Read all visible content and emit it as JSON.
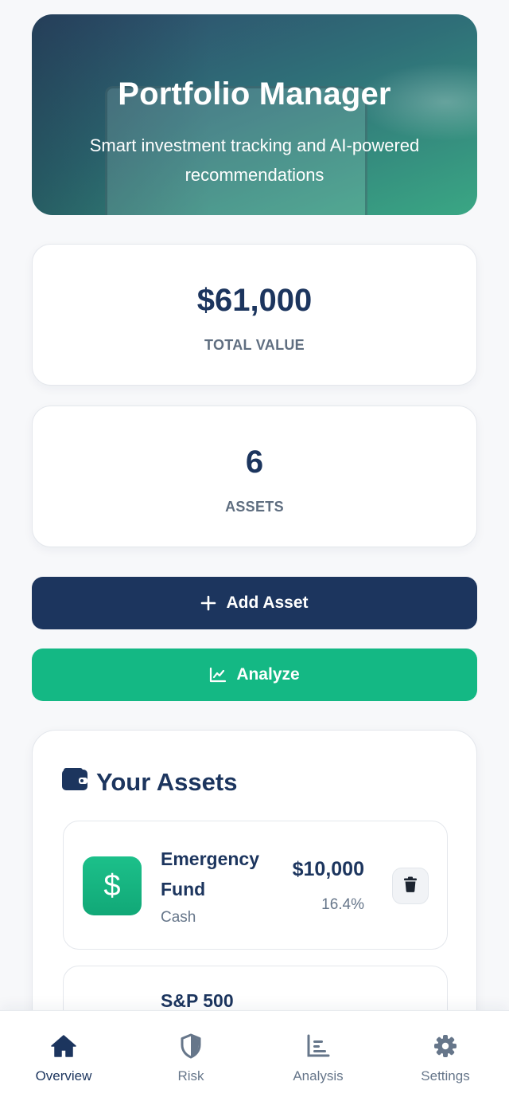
{
  "hero": {
    "title": "Portfolio Manager",
    "subtitle": "Smart investment tracking and AI-powered recommendations"
  },
  "stats": {
    "total_value": "$61,000",
    "total_value_label": "TOTAL VALUE",
    "asset_count": "6",
    "asset_count_label": "ASSETS"
  },
  "actions": {
    "add_label": "Add Asset",
    "add_icon": "plus-icon",
    "analyze_label": "Analyze",
    "analyze_icon": "line-chart-icon"
  },
  "assets": {
    "title": "Your Assets",
    "title_icon": "wallet-icon",
    "items": [
      {
        "name": "Emergency Fund",
        "type": "Cash",
        "value": "$10,000",
        "percent": "16.4%",
        "icon": "dollar-icon",
        "icon_symbol": "$"
      },
      {
        "name": "S&P 500"
      }
    ]
  },
  "nav": {
    "active": "Overview",
    "items": [
      {
        "label": "Overview",
        "icon": "home-icon"
      },
      {
        "label": "Risk",
        "icon": "shield-icon"
      },
      {
        "label": "Analysis",
        "icon": "bar-chart-icon"
      },
      {
        "label": "Settings",
        "icon": "gear-icon"
      }
    ]
  },
  "colors": {
    "navy": "#1c355e",
    "green": "#14b884",
    "muted": "#66768a",
    "background": "#f7f8fa"
  }
}
